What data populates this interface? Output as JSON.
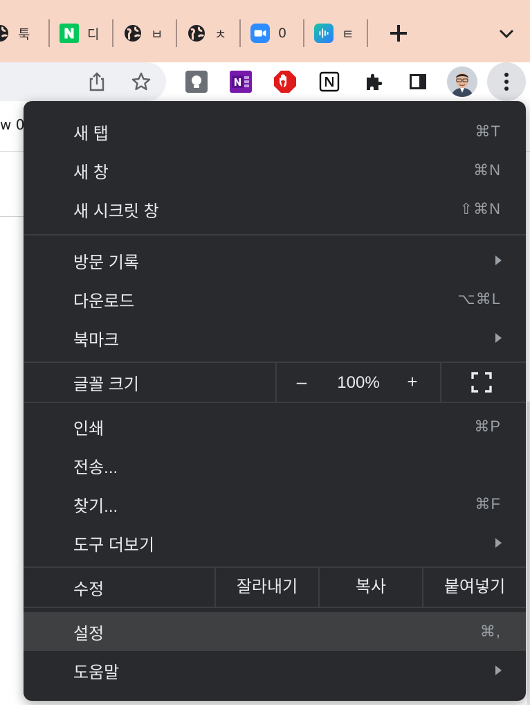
{
  "tabs": [
    {
      "title": "툭",
      "favicon": "globe-icon"
    },
    {
      "title": "디",
      "favicon": "naver-n-icon"
    },
    {
      "title": "ㅂ",
      "favicon": "globe-icon"
    },
    {
      "title": "ㅊ",
      "favicon": "globe-icon"
    },
    {
      "title": "0",
      "favicon": "zoom-video-icon"
    },
    {
      "title": "ㅌ",
      "favicon": "clova-note-icon"
    }
  ],
  "toolbar": {
    "extensions": [
      "lightbulb-extension-icon",
      "onenote-icon",
      "adblock-hand-icon",
      "notion-icon",
      "puzzle-extensions-icon",
      "sidepanel-icon"
    ]
  },
  "page": {
    "fragment_text": "w 0"
  },
  "menu": {
    "group1": [
      {
        "label": "새 탭",
        "shortcut": "⌘T"
      },
      {
        "label": "새 창",
        "shortcut": "⌘N"
      },
      {
        "label": "새 시크릿 창",
        "shortcut": "⇧⌘N"
      }
    ],
    "group2": [
      {
        "label": "방문 기록",
        "shortcut": ""
      },
      {
        "label": "다운로드",
        "shortcut": "⌥⌘L"
      },
      {
        "label": "북마크",
        "shortcut": ""
      }
    ],
    "zoom": {
      "label": "글꼴 크기",
      "minus": "–",
      "value": "100%",
      "plus": "+"
    },
    "group3": [
      {
        "label": "인쇄",
        "shortcut": "⌘P"
      },
      {
        "label": "전송...",
        "shortcut": ""
      },
      {
        "label": "찾기...",
        "shortcut": "⌘F"
      },
      {
        "label": "도구 더보기",
        "shortcut": ""
      }
    ],
    "edit": {
      "label": "수정",
      "cut": "잘라내기",
      "copy": "복사",
      "paste": "붙여넣기"
    },
    "group4": [
      {
        "label": "설정",
        "shortcut": "⌘,"
      },
      {
        "label": "도움말",
        "shortcut": ""
      }
    ]
  },
  "colors": {
    "tabstrip_bg": "#f8d6c6",
    "menu_bg": "#292a2d",
    "menu_highlight": "#3f4042",
    "menu_text": "#e8eaed",
    "menu_shortcut": "#9aa0a6"
  }
}
